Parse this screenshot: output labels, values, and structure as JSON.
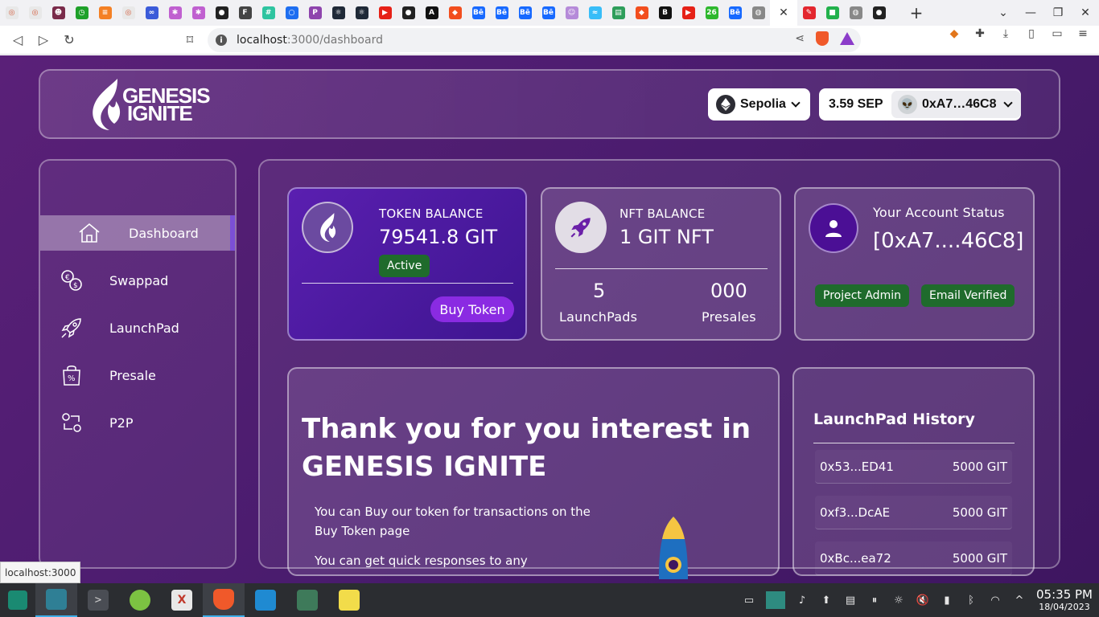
{
  "browser": {
    "tab_favicons": [
      {
        "name": "brave-shield-tab",
        "color": "#e8e8e8",
        "glyph": "◎"
      },
      {
        "name": "brave-shield-tab",
        "color": "#e8e8e8",
        "glyph": "◎"
      },
      {
        "name": "avatar-tab",
        "color": "#7a2b4a",
        "glyph": "☻"
      },
      {
        "name": "upwork-clock-tab",
        "color": "#1fa12a",
        "glyph": "◷"
      },
      {
        "name": "stackoverflow-tab",
        "color": "#f48024",
        "glyph": "≡"
      },
      {
        "name": "brave-shield-tab",
        "color": "#e8e8e8",
        "glyph": "◎"
      },
      {
        "name": "glasses-tab",
        "color": "#3b5bd9",
        "glyph": "∞"
      },
      {
        "name": "snowflake-tab",
        "color": "#c060d0",
        "glyph": "✱"
      },
      {
        "name": "snowflake-tab",
        "color": "#c060d0",
        "glyph": "✱"
      },
      {
        "name": "github-tab",
        "color": "#222222",
        "glyph": "●"
      },
      {
        "name": "pdf-tab",
        "color": "#444444",
        "glyph": "F"
      },
      {
        "name": "teal-tab",
        "color": "#2ec4a0",
        "glyph": "#"
      },
      {
        "name": "blue-circle-tab",
        "color": "#1e6ef0",
        "glyph": "○"
      },
      {
        "name": "purple-p-tab",
        "color": "#8e44ad",
        "glyph": "P"
      },
      {
        "name": "react-tab",
        "color": "#1f2937",
        "glyph": "⚛"
      },
      {
        "name": "react-tab",
        "color": "#1f2937",
        "glyph": "⚛"
      },
      {
        "name": "youtube-tab",
        "color": "#e62117",
        "glyph": "▶"
      },
      {
        "name": "github-tab",
        "color": "#222222",
        "glyph": "●"
      },
      {
        "name": "font-tab",
        "color": "#111111",
        "glyph": "A"
      },
      {
        "name": "figma-tab",
        "color": "#f24e1e",
        "glyph": "◆"
      },
      {
        "name": "behance-tab",
        "color": "#1769ff",
        "glyph": "Bē"
      },
      {
        "name": "behance-tab",
        "color": "#1769ff",
        "glyph": "Bē"
      },
      {
        "name": "behance-tab",
        "color": "#1769ff",
        "glyph": "Bē"
      },
      {
        "name": "behance-tab",
        "color": "#1769ff",
        "glyph": "Bē"
      },
      {
        "name": "smile-tab",
        "color": "#b58ad9",
        "glyph": "☺"
      },
      {
        "name": "tailwind-tab",
        "color": "#38bdf8",
        "glyph": "≈"
      },
      {
        "name": "green-grid-tab",
        "color": "#2e9e5b",
        "glyph": "▤"
      },
      {
        "name": "figma-tab",
        "color": "#f24e1e",
        "glyph": "◆"
      },
      {
        "name": "b-circle-tab",
        "color": "#111111",
        "glyph": "B"
      },
      {
        "name": "youtube-tab",
        "color": "#e62117",
        "glyph": "▶"
      },
      {
        "name": "number-tab",
        "color": "#2eb82e",
        "glyph": "26"
      },
      {
        "name": "behance-tab",
        "color": "#1769ff",
        "glyph": "Bē"
      },
      {
        "name": "globe-tab",
        "color": "#888888",
        "glyph": "◍"
      }
    ],
    "after_active_tabs": [
      {
        "name": "red-pen-tab",
        "color": "#e3262e",
        "glyph": "✎"
      },
      {
        "name": "green-square-tab",
        "color": "#22b14c",
        "glyph": "■"
      },
      {
        "name": "globe-tab",
        "color": "#888888",
        "glyph": "◍"
      },
      {
        "name": "github-tab",
        "color": "#222222",
        "glyph": "●"
      }
    ],
    "new_tab_label": "+",
    "url_host": "localhost",
    "url_rest": ":3000/dashboard",
    "status_tooltip": "localhost:3000"
  },
  "header": {
    "logo_line1": "GENESIS",
    "logo_line2": "IGNITE",
    "network_label": "Sepolia",
    "balance": "3.59 SEP",
    "address": "0xA7…46C8"
  },
  "sidebar": {
    "items": [
      {
        "label": "Dashboard"
      },
      {
        "label": "Swappad"
      },
      {
        "label": "LaunchPad"
      },
      {
        "label": "Presale"
      },
      {
        "label": "P2P"
      }
    ]
  },
  "token_card": {
    "title": "TOKEN BALANCE",
    "value": "79541.8 GIT",
    "status": "Active",
    "buy_label": "Buy Token"
  },
  "nft_card": {
    "title": "NFT BALANCE",
    "value": "1 GIT NFT",
    "launchpads_count": "5",
    "launchpads_label": "LaunchPads",
    "presales_count": "000",
    "presales_label": "Presales"
  },
  "status_card": {
    "title": "Your Account Status",
    "address": "[0xA7....46C8]",
    "badge1": "Project Admin",
    "badge2": "Email Verified"
  },
  "welcome": {
    "title": "Thank you for you interest in GENESIS IGNITE",
    "p1": "You can Buy our token for transactions on the Buy Token page",
    "p2": "You can get quick responses to any"
  },
  "history": {
    "title": "LaunchPad History",
    "rows": [
      {
        "address": "0x53...ED41",
        "amount": "5000 GIT"
      },
      {
        "address": "0xf3...DcAE",
        "amount": "5000 GIT"
      },
      {
        "address": "0xBc...ea72",
        "amount": "5000 GIT"
      }
    ]
  },
  "taskbar": {
    "time": "05:35 PM",
    "date": "18/04/2023"
  },
  "colors": {
    "page_bg": "#4a1c6e",
    "token_card": "#5a1fb0",
    "badge_green": "#1f6b2c",
    "buy_button": "#8a2be2"
  }
}
